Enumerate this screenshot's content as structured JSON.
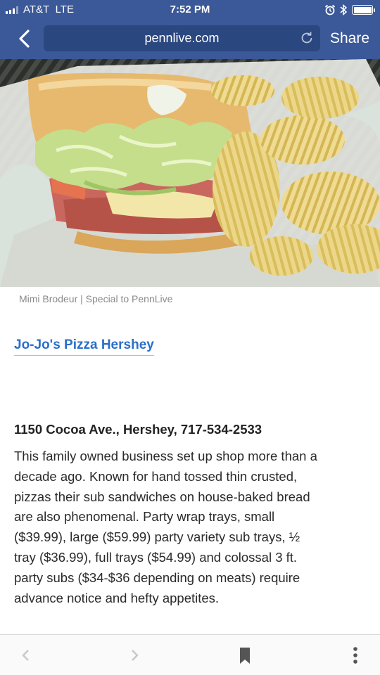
{
  "status_bar": {
    "carrier": "AT&T",
    "network": "LTE",
    "time": "7:52 PM"
  },
  "browser": {
    "url": "pennlive.com",
    "share_label": "Share",
    "icons": [
      "back-chevron-icon",
      "reload-icon",
      "nav-back-icon",
      "nav-forward-icon",
      "bookmark-icon",
      "more-icon"
    ]
  },
  "article": {
    "photo_subject": "sub sandwich with lettuce, ham and cheese with ridged potato chips in a basket",
    "photo_credit": "Mimi Brodeur | Special to PennLive",
    "place_name": "Jo-Jo's Pizza Hershey",
    "address": "1150 Cocoa Ave., Hershey, 717-534-2533",
    "description_lines": [
      "This family owned business set up shop more than a",
      "decade ago.  Known for hand tossed thin crusted,",
      "pizzas their sub sandwiches on house-baked bread",
      "are also phenomenal. Party wrap trays, small",
      "($39.99), large ($59.99) party variety sub trays, ½",
      "tray ($36.99), full trays ($54.99) and colossal 3 ft.",
      "party subs ($34-$36 depending on meats) require",
      "advance notice and hefty appetites."
    ]
  },
  "colors": {
    "toolbar_bg": "#3b5998",
    "url_box": "#2b477f",
    "link": "#2a6fc9",
    "caption": "#8a8a8a",
    "text": "#2a2a2a"
  }
}
